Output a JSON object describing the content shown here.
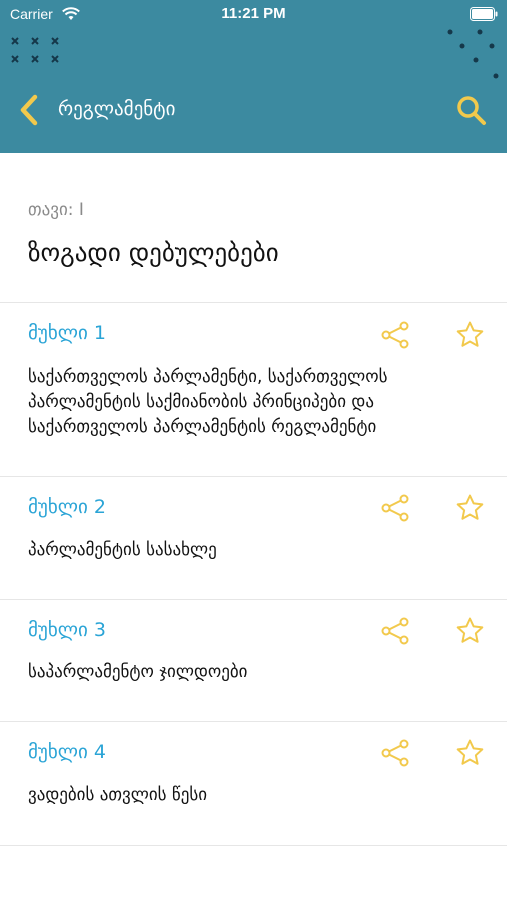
{
  "status_bar": {
    "carrier": "Carrier",
    "time": "11:21 PM"
  },
  "nav": {
    "title": "რეგლამენტი",
    "back_icon": "chevron-left-icon",
    "search_icon": "search-icon"
  },
  "chapter": {
    "label": "თავი: I",
    "title": "ზოგადი დებულებები"
  },
  "articles": [
    {
      "number": "მუხლი 1",
      "text": "საქართველოს პარლამენტი, საქართველოს პარლამენტის საქმიანობის პრინციპები და საქართველოს პარლამენტის რეგლამენტი"
    },
    {
      "number": "მუხლი 2",
      "text": "პარლამენტის სასახლე"
    },
    {
      "number": "მუხლი 3",
      "text": "საპარლამენტო ჯილდოები"
    },
    {
      "number": "მუხლი 4",
      "text": "ვადების ათვლის წესი"
    }
  ],
  "colors": {
    "header": "#3c8aa0",
    "accent_yellow": "#f2c94c",
    "link_blue": "#2aa4d6"
  }
}
